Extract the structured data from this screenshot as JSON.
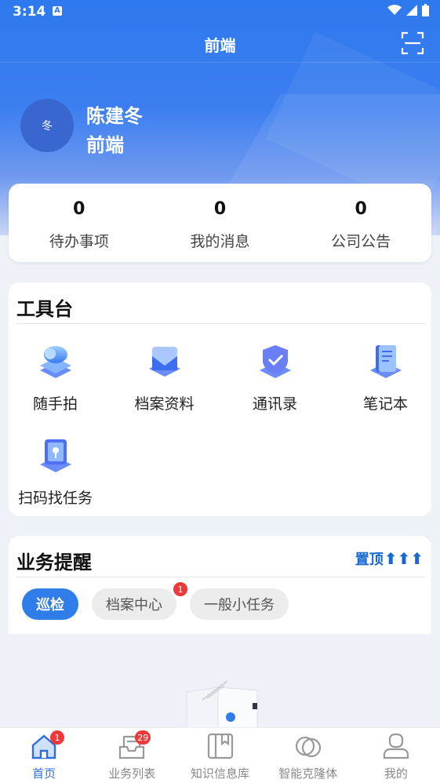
{
  "status": {
    "time": "3:14",
    "a_icon": "A"
  },
  "appbar": {
    "title": "前端",
    "scan_icon": "scan-icon"
  },
  "user": {
    "avatar_text": "冬",
    "name": "陈建冬",
    "dept": "前端"
  },
  "stats": [
    {
      "value": "0",
      "label": "待办事项"
    },
    {
      "value": "0",
      "label": "我的消息"
    },
    {
      "value": "0",
      "label": "公司公告"
    }
  ],
  "tools": {
    "title": "工具台",
    "items": [
      {
        "label": "随手拍",
        "icon": "cloud-stack-icon"
      },
      {
        "label": "档案资料",
        "icon": "mail-box-icon"
      },
      {
        "label": "通讯录",
        "icon": "shield-check-icon"
      },
      {
        "label": "笔记本",
        "icon": "notebook-icon"
      },
      {
        "label": "扫码找任务",
        "icon": "scan-task-icon"
      }
    ]
  },
  "reminder": {
    "title": "业务提醒",
    "pin_label": "置顶",
    "chips": [
      {
        "label": "巡检",
        "active": true
      },
      {
        "label": "档案中心",
        "badge": "1"
      },
      {
        "label": "一般小任务"
      }
    ]
  },
  "tabbar": [
    {
      "label": "首页",
      "badge": "1",
      "active": true
    },
    {
      "label": "业务列表",
      "badge": "29"
    },
    {
      "label": "知识信息库"
    },
    {
      "label": "智能克隆体"
    },
    {
      "label": "我的"
    }
  ],
  "colors": {
    "primary": "#2f7de8",
    "badge": "#ec3a3a",
    "pin": "#1769d0"
  }
}
